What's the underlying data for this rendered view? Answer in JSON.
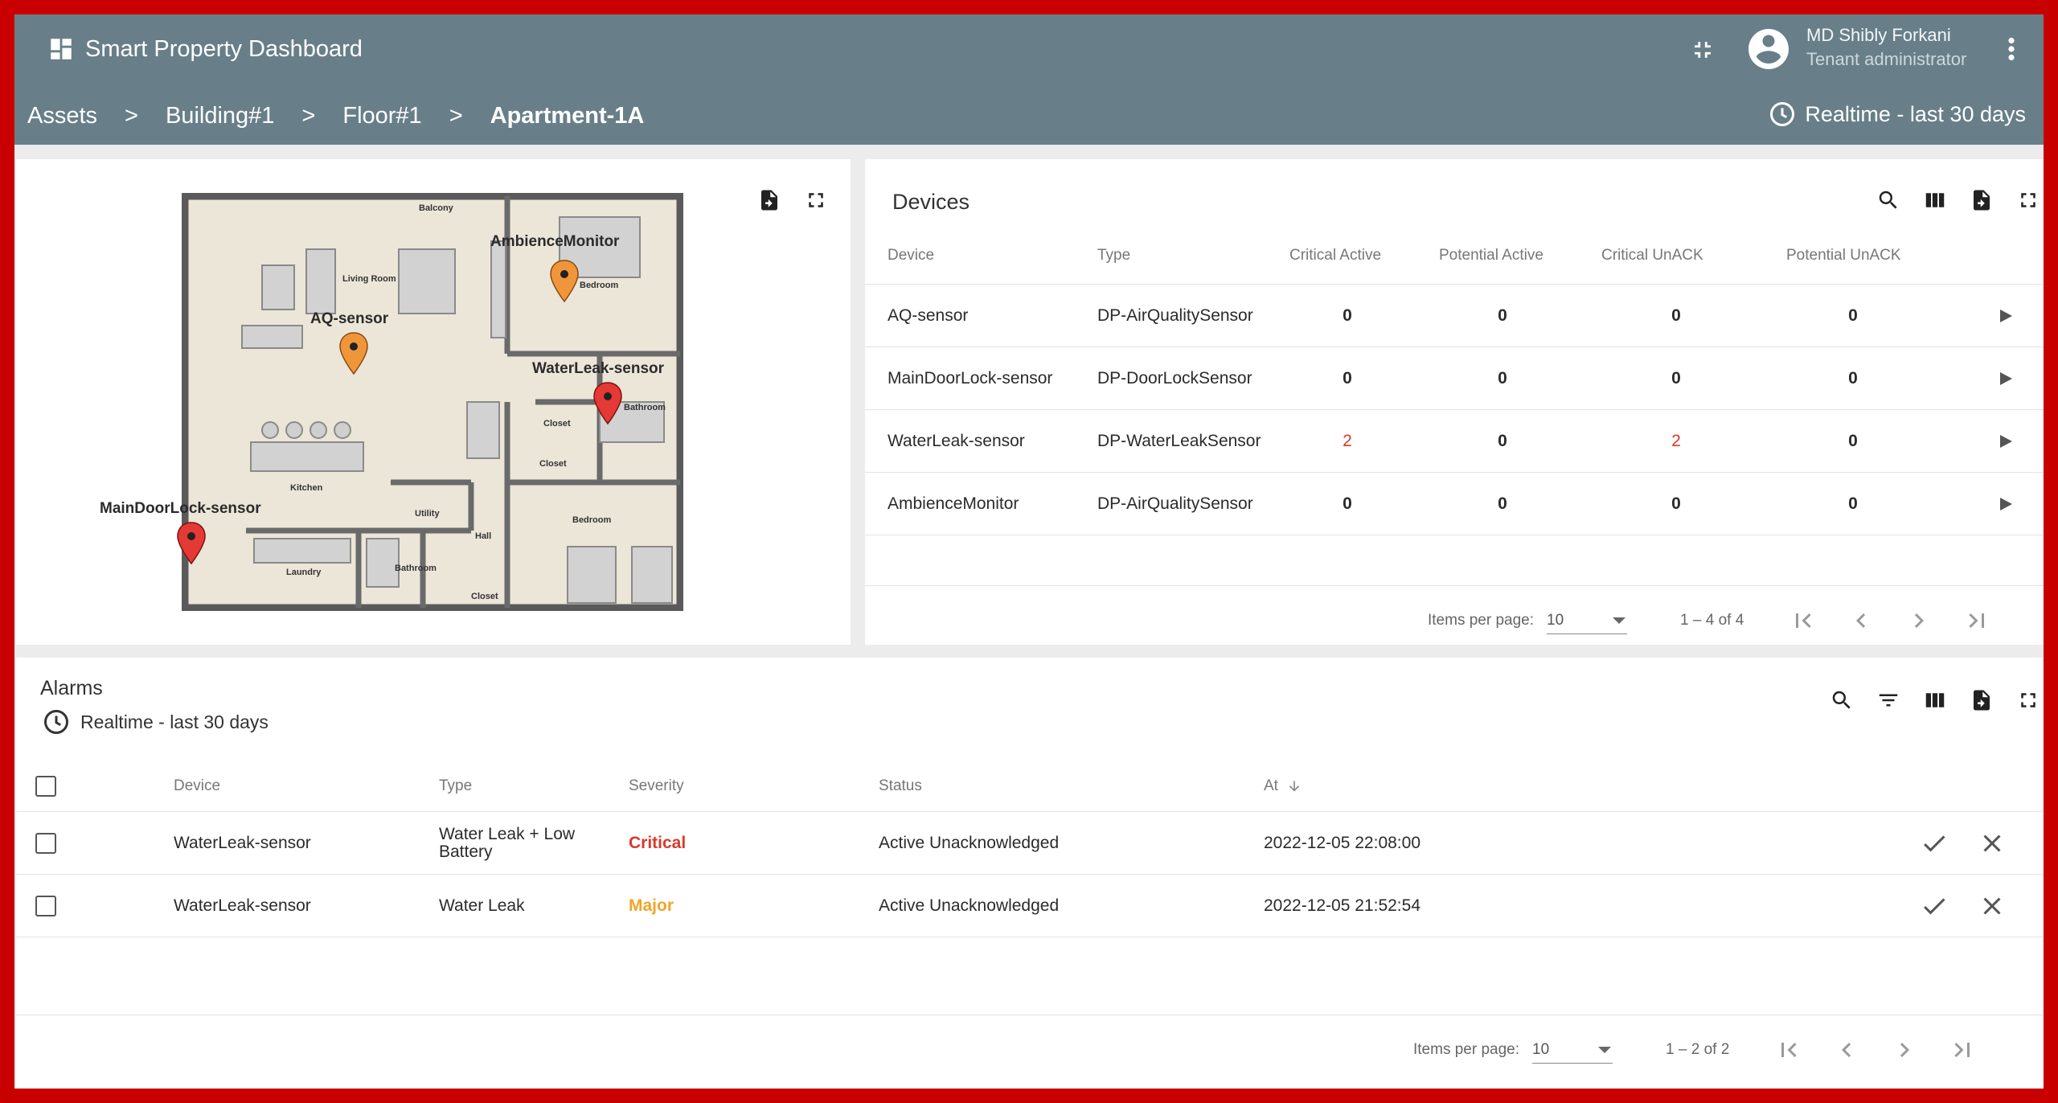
{
  "app": {
    "title": "Smart Property Dashboard",
    "user_name": "MD Shibly Forkani",
    "user_role": "Tenant administrator"
  },
  "breadcrumbs": [
    "Assets",
    "Building#1",
    "Floor#1",
    "Apartment-1A"
  ],
  "breadcrumb_separator": ">",
  "timewindow": "Realtime - last 30 days",
  "map": {
    "rooms": [
      "Balcony",
      "Living Room",
      "Bedroom",
      "Closet",
      "Bathroom",
      "Closet",
      "Kitchen",
      "Utility",
      "Hall",
      "Bedroom",
      "Laundry",
      "Bathroom",
      "Closet"
    ],
    "markers": [
      {
        "label": "AmbienceMonitor",
        "color": "#f0963a"
      },
      {
        "label": "AQ-sensor",
        "color": "#f0963a"
      },
      {
        "label": "WaterLeak-sensor",
        "color": "#e53935"
      },
      {
        "label": "MainDoorLock-sensor",
        "color": "#e53935"
      }
    ]
  },
  "devices": {
    "title": "Devices",
    "columns": [
      "Device",
      "Type",
      "Critical Active",
      "Potential Active",
      "Critical UnACK",
      "Potential UnACK"
    ],
    "rows": [
      {
        "device": "AQ-sensor",
        "type": "DP-AirQualitySensor",
        "critical_active": "0",
        "potential_active": "0",
        "critical_unack": "0",
        "potential_unack": "0"
      },
      {
        "device": "MainDoorLock-sensor",
        "type": "DP-DoorLockSensor",
        "critical_active": "0",
        "potential_active": "0",
        "critical_unack": "0",
        "potential_unack": "0"
      },
      {
        "device": "WaterLeak-sensor",
        "type": "DP-WaterLeakSensor",
        "critical_active": "2",
        "potential_active": "0",
        "critical_unack": "2",
        "potential_unack": "0"
      },
      {
        "device": "AmbienceMonitor",
        "type": "DP-AirQualitySensor",
        "critical_active": "0",
        "potential_active": "0",
        "critical_unack": "0",
        "potential_unack": "0"
      }
    ],
    "pager": {
      "label": "Items per page:",
      "page_size": "10",
      "range": "1 – 4 of 4"
    }
  },
  "alarms": {
    "title": "Alarms",
    "timewindow": "Realtime - last 30 days",
    "columns": [
      "Device",
      "Type",
      "Severity",
      "Status",
      "At"
    ],
    "rows": [
      {
        "device": "WaterLeak-sensor",
        "type": "Water Leak + Low Battery",
        "severity": "Critical",
        "status": "Active Unacknowledged",
        "at": "2022-12-05 22:08:00"
      },
      {
        "device": "WaterLeak-sensor",
        "type": "Water Leak",
        "severity": "Major",
        "status": "Active Unacknowledged",
        "at": "2022-12-05 21:52:54"
      }
    ],
    "pager": {
      "label": "Items per page:",
      "page_size": "10",
      "range": "1 – 2 of 2"
    }
  },
  "colors": {
    "toolbar": "#687f8a",
    "critical": "#d7392b",
    "major": "#f0a52a",
    "frame": "#c80000"
  },
  "icons": [
    "dashboard-icon",
    "fullscreen-exit-icon",
    "account-circle-icon",
    "more-vert-icon",
    "clock-icon",
    "export-icon",
    "fullscreen-icon",
    "search-icon",
    "columns-icon",
    "filter-icon",
    "play-arrow-icon",
    "first-page-icon",
    "prev-page-icon",
    "next-page-icon",
    "last-page-icon",
    "check-icon",
    "close-icon"
  ]
}
